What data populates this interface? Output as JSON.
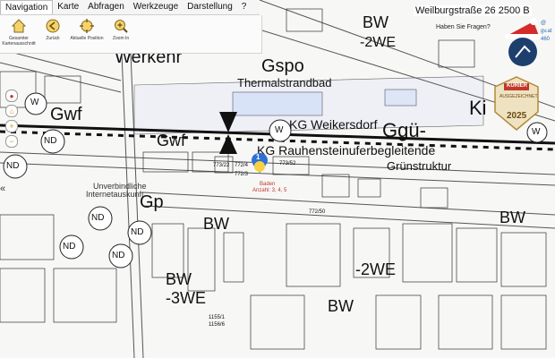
{
  "menu": {
    "items": [
      "Navigation",
      "Karte",
      "Abfragen",
      "Werkzeuge",
      "Darstellung",
      "?"
    ],
    "active_index": 0
  },
  "toolbar": {
    "tools": [
      {
        "label": "Gesamter Kartenausschnitt",
        "icon": "home-icon"
      },
      {
        "label": "Zurück",
        "icon": "back-icon"
      },
      {
        "label": "Aktuelle Position",
        "icon": "position-icon"
      },
      {
        "label": "Zoom In",
        "icon": "zoom-in-icon"
      }
    ]
  },
  "address": {
    "text": "Weilburgstraße 26 2500 B",
    "question": "Haben Sie Fragen?"
  },
  "side_contact": [
    "@",
    "gv.at",
    "460"
  ],
  "badge": {
    "icon": "christmas-hat-logo-icon"
  },
  "award": {
    "brand": "KURIER",
    "subtitle": "AUSGEZEICHNET",
    "year": "2025",
    "icon": "award-badge-icon"
  },
  "marker": {
    "number": "1",
    "icon": "location-pin-icon"
  },
  "map": {
    "zones": {
      "gspo": "Gspo",
      "thermal": "Thermalstrandbad",
      "kg_weikersdorf": "KG Weikersdorf",
      "kg_rauhenstein": "KG Rauhensteinuferbegleitende",
      "ggu": "Ggü-",
      "gruen": "Grünstruktur",
      "gwf": "Gwf",
      "gp": "Gp",
      "bw": "BW",
      "bw_2we": "-2WE",
      "bw_3we": "-3WE",
      "ki": "Ki",
      "werkehr": "Werkehr",
      "nd": "ND",
      "w": "W",
      "unv1": "Unverbindliche",
      "unv2": "Internetauskunft",
      "baden1": "Baden",
      "baden2": "Anzahl: 3, 4, 5"
    },
    "parcels": [
      "772/3",
      "772/4",
      "772/5",
      "772/6",
      "772/50",
      "773/52",
      "773/22",
      "1155/1",
      "1156/6"
    ]
  }
}
